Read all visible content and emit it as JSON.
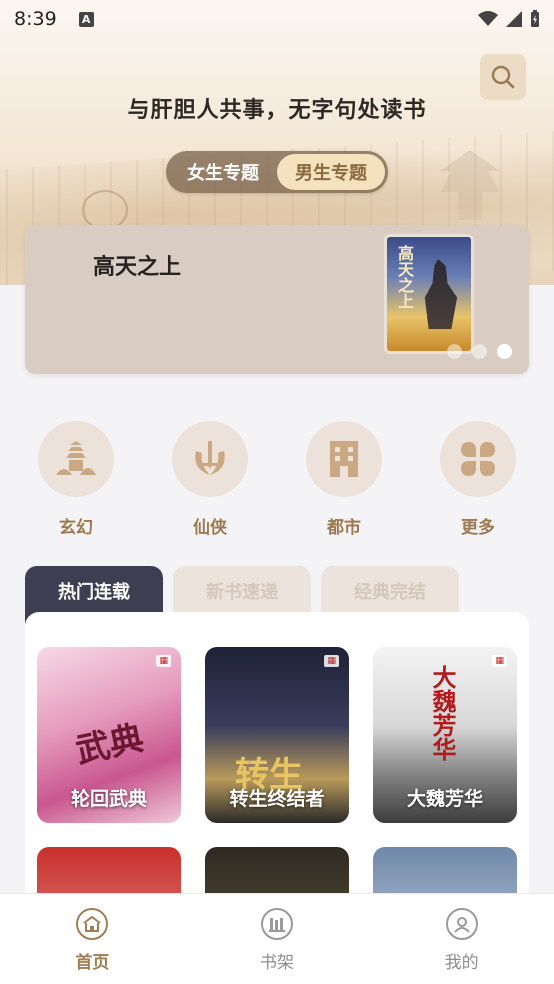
{
  "status_bar": {
    "time": "8:39",
    "notif_letter": "A"
  },
  "header": {
    "slogan": "与肝胆人共事，无字句处读书",
    "search_icon": "search-icon",
    "gender_tabs": [
      {
        "label": "女生专题",
        "active": false
      },
      {
        "label": "男生专题",
        "active": true
      }
    ]
  },
  "banner": {
    "title": "高天之上",
    "cover_text": "高天之上",
    "dots": [
      false,
      false,
      true
    ]
  },
  "categories": [
    {
      "label": "玄幻",
      "icon": "pagoda-icon"
    },
    {
      "label": "仙侠",
      "icon": "sword-icon"
    },
    {
      "label": "都市",
      "icon": "building-icon"
    },
    {
      "label": "更多",
      "icon": "four-petal-icon"
    }
  ],
  "tabs": [
    {
      "label": "热门连载",
      "active": true
    },
    {
      "label": "新书速递",
      "active": false
    },
    {
      "label": "经典完结",
      "active": false
    }
  ],
  "books": [
    {
      "title": "轮回武典",
      "cover_text": "武典"
    },
    {
      "title": "转生终结者",
      "cover_text": "转生"
    },
    {
      "title": "大魏芳华",
      "cover_text": "大魏芳华"
    },
    {
      "title": "",
      "cover_text": ""
    },
    {
      "title": "",
      "cover_text": ""
    },
    {
      "title": "",
      "cover_text": ""
    }
  ],
  "bottom_nav": [
    {
      "label": "首页",
      "icon": "home-icon",
      "active": true
    },
    {
      "label": "书架",
      "icon": "bookshelf-icon",
      "active": false
    },
    {
      "label": "我的",
      "icon": "profile-icon",
      "active": false
    }
  ],
  "colors": {
    "accent": "#a07f55",
    "tab_active": "#3d3e52",
    "banner_bg": "#d9cdc3"
  }
}
